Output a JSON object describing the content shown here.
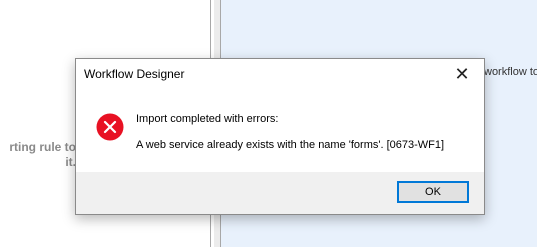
{
  "background": {
    "left_text": "rting rule to it.",
    "right_text": "workflow to"
  },
  "dialog": {
    "title": "Workflow Designer",
    "close_glyph": "✕",
    "icon": "error-icon",
    "message_heading": "Import completed with errors:",
    "message_detail": "A web service already exists with the name 'forms'. [0673-WF1]",
    "ok_label": "OK"
  },
  "colors": {
    "error_red": "#e81123",
    "focus_blue": "#0078d7",
    "footer_bg": "#f0f0f0",
    "right_pane_bg": "#e8f1fc"
  }
}
